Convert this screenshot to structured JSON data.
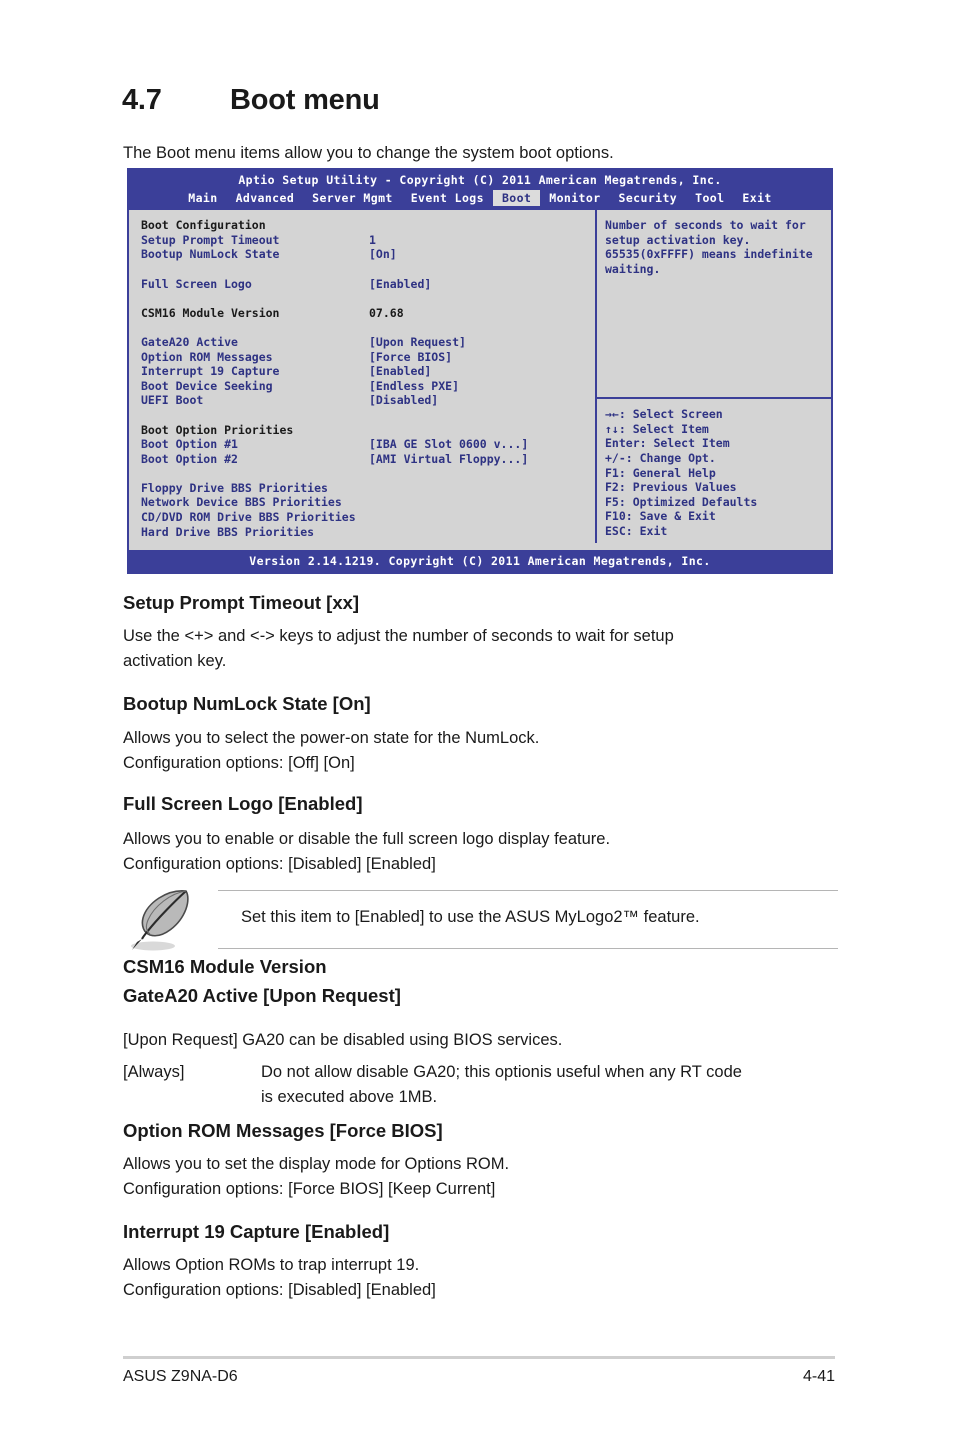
{
  "section": {
    "number": "4.7",
    "title": "Boot menu",
    "intro": "The Boot menu items allow you to change the system boot options."
  },
  "bios": {
    "title": "Aptio Setup Utility - Copyright (C) 2011 American Megatrends, Inc.",
    "tabs": [
      {
        "label": "Main",
        "active": false
      },
      {
        "label": "Advanced",
        "active": false
      },
      {
        "label": "Server Mgmt",
        "active": false
      },
      {
        "label": "Event Logs",
        "active": false
      },
      {
        "label": "Boot",
        "active": true
      },
      {
        "label": "Monitor",
        "active": false
      },
      {
        "label": "Security",
        "active": false
      },
      {
        "label": "Tool",
        "active": false
      },
      {
        "label": "Exit",
        "active": false
      }
    ],
    "left_rows": [
      {
        "type": "group",
        "label": "Boot Configuration",
        "value": ""
      },
      {
        "type": "item",
        "label": "Setup Prompt Timeout",
        "value": "1"
      },
      {
        "type": "item",
        "label": "Bootup NumLock State",
        "value": "[On]"
      },
      {
        "type": "blank"
      },
      {
        "type": "item",
        "label": "Full Screen Logo",
        "value": "[Enabled]"
      },
      {
        "type": "blank"
      },
      {
        "type": "plain",
        "label": "CSM16 Module Version",
        "value": "07.68"
      },
      {
        "type": "blank"
      },
      {
        "type": "item",
        "label": "GateA20 Active",
        "value": "[Upon Request]"
      },
      {
        "type": "item",
        "label": "Option ROM Messages",
        "value": "[Force BIOS]"
      },
      {
        "type": "item",
        "label": "Interrupt 19 Capture",
        "value": "[Enabled]"
      },
      {
        "type": "item",
        "label": "Boot Device Seeking",
        "value": "[Endless PXE]"
      },
      {
        "type": "item",
        "label": "UEFI Boot",
        "value": "[Disabled]"
      },
      {
        "type": "blank"
      },
      {
        "type": "group",
        "label": "Boot Option Priorities",
        "value": ""
      },
      {
        "type": "item",
        "label": "Boot Option #1",
        "value": "[IBA GE Slot 0600 v...]"
      },
      {
        "type": "item",
        "label": "Boot Option #2",
        "value": "[AMI Virtual Floppy...]"
      },
      {
        "type": "blank"
      },
      {
        "type": "item",
        "label": "Floppy Drive BBS Priorities",
        "value": ""
      },
      {
        "type": "item",
        "label": "Network Device BBS Priorities",
        "value": ""
      },
      {
        "type": "item",
        "label": "CD/DVD ROM Drive BBS Priorities",
        "value": ""
      },
      {
        "type": "item",
        "label": "Hard Drive BBS Priorities",
        "value": ""
      }
    ],
    "help_text": "Number of seconds to wait for\nsetup activation key.\n65535(0xFFFF) means indefinite\nwaiting.",
    "help_keys": "→←: Select Screen\n↑↓:  Select Item\nEnter: Select Item\n+/-: Change Opt.\nF1: General Help\nF2: Previous Values\nF5: Optimized Defaults\nF10: Save & Exit\nESC: Exit",
    "footer": "Version 2.14.1219. Copyright (C) 2011 American Megatrends, Inc."
  },
  "topics": {
    "setup_prompt_timeout": {
      "heading": "Setup Prompt Timeout [xx]",
      "body": "Use the <+> and <-> keys to adjust the number of seconds to wait for setup\nactivation key."
    },
    "bootup_numlock": {
      "heading": "Bootup NumLock State [On]",
      "body": "Allows you to select the power-on state for the NumLock.\nConfiguration options: [Off] [On]"
    },
    "full_screen_logo": {
      "heading": "Full Screen Logo [Enabled]",
      "body": "Allows you to enable or disable the full screen logo display feature.\nConfiguration options: [Disabled] [Enabled]"
    },
    "note": {
      "text": "Set this item to [Enabled] to use the ASUS MyLogo2™ feature."
    },
    "csm16": {
      "heading_line1": "CSM16 Module Version",
      "heading_line2": "GateA20 Active [Upon Request]",
      "option1_label": "[Upon Request]",
      "option1_text": "GA20 can be disabled using BIOS services.",
      "option2_label": "[Always]",
      "option2_text": "Do not allow disable GA20; this optionis useful when any RT code\nis executed above 1MB."
    },
    "option_rom": {
      "heading": "Option ROM Messages [Force BIOS]",
      "body": "Allows you to set the display mode for Options ROM.\nConfiguration options: [Force BIOS] [Keep Current]"
    },
    "interrupt19": {
      "heading": "Interrupt 19 Capture [Enabled]",
      "body": "Allows Option ROMs to trap interrupt 19.\nConfiguration options: [Disabled] [Enabled]"
    }
  },
  "footer": {
    "product": "ASUS Z9NA-D6",
    "page": "4-41"
  },
  "colors": {
    "bios_blue": "#3b3f99",
    "bios_text_blue": "#2e3283",
    "bios_panel_gray": "#d4d4d4",
    "tab_active_bg": "#dcdcdc"
  }
}
